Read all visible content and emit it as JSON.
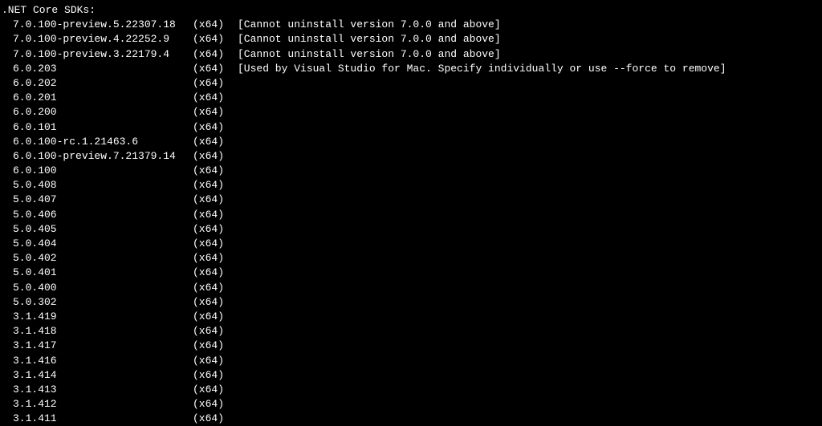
{
  "header": ".NET Core SDKs:",
  "sdks": [
    {
      "version": "7.0.100-preview.5.22307.18",
      "arch": "(x64)",
      "note": "[Cannot uninstall version 7.0.0 and above]"
    },
    {
      "version": "7.0.100-preview.4.22252.9",
      "arch": "(x64)",
      "note": "[Cannot uninstall version 7.0.0 and above]"
    },
    {
      "version": "7.0.100-preview.3.22179.4",
      "arch": "(x64)",
      "note": "[Cannot uninstall version 7.0.0 and above]"
    },
    {
      "version": "6.0.203",
      "arch": "(x64)",
      "note": "[Used by Visual Studio for Mac. Specify individually or use --force to remove]"
    },
    {
      "version": "6.0.202",
      "arch": "(x64)",
      "note": ""
    },
    {
      "version": "6.0.201",
      "arch": "(x64)",
      "note": ""
    },
    {
      "version": "6.0.200",
      "arch": "(x64)",
      "note": ""
    },
    {
      "version": "6.0.101",
      "arch": "(x64)",
      "note": ""
    },
    {
      "version": "6.0.100-rc.1.21463.6",
      "arch": "(x64)",
      "note": ""
    },
    {
      "version": "6.0.100-preview.7.21379.14",
      "arch": "(x64)",
      "note": ""
    },
    {
      "version": "6.0.100",
      "arch": "(x64)",
      "note": ""
    },
    {
      "version": "5.0.408",
      "arch": "(x64)",
      "note": ""
    },
    {
      "version": "5.0.407",
      "arch": "(x64)",
      "note": ""
    },
    {
      "version": "5.0.406",
      "arch": "(x64)",
      "note": ""
    },
    {
      "version": "5.0.405",
      "arch": "(x64)",
      "note": ""
    },
    {
      "version": "5.0.404",
      "arch": "(x64)",
      "note": ""
    },
    {
      "version": "5.0.402",
      "arch": "(x64)",
      "note": ""
    },
    {
      "version": "5.0.401",
      "arch": "(x64)",
      "note": ""
    },
    {
      "version": "5.0.400",
      "arch": "(x64)",
      "note": ""
    },
    {
      "version": "5.0.302",
      "arch": "(x64)",
      "note": ""
    },
    {
      "version": "3.1.419",
      "arch": "(x64)",
      "note": ""
    },
    {
      "version": "3.1.418",
      "arch": "(x64)",
      "note": ""
    },
    {
      "version": "3.1.417",
      "arch": "(x64)",
      "note": ""
    },
    {
      "version": "3.1.416",
      "arch": "(x64)",
      "note": ""
    },
    {
      "version": "3.1.414",
      "arch": "(x64)",
      "note": ""
    },
    {
      "version": "3.1.413",
      "arch": "(x64)",
      "note": ""
    },
    {
      "version": "3.1.412",
      "arch": "(x64)",
      "note": ""
    },
    {
      "version": "3.1.411",
      "arch": "(x64)",
      "note": ""
    }
  ]
}
